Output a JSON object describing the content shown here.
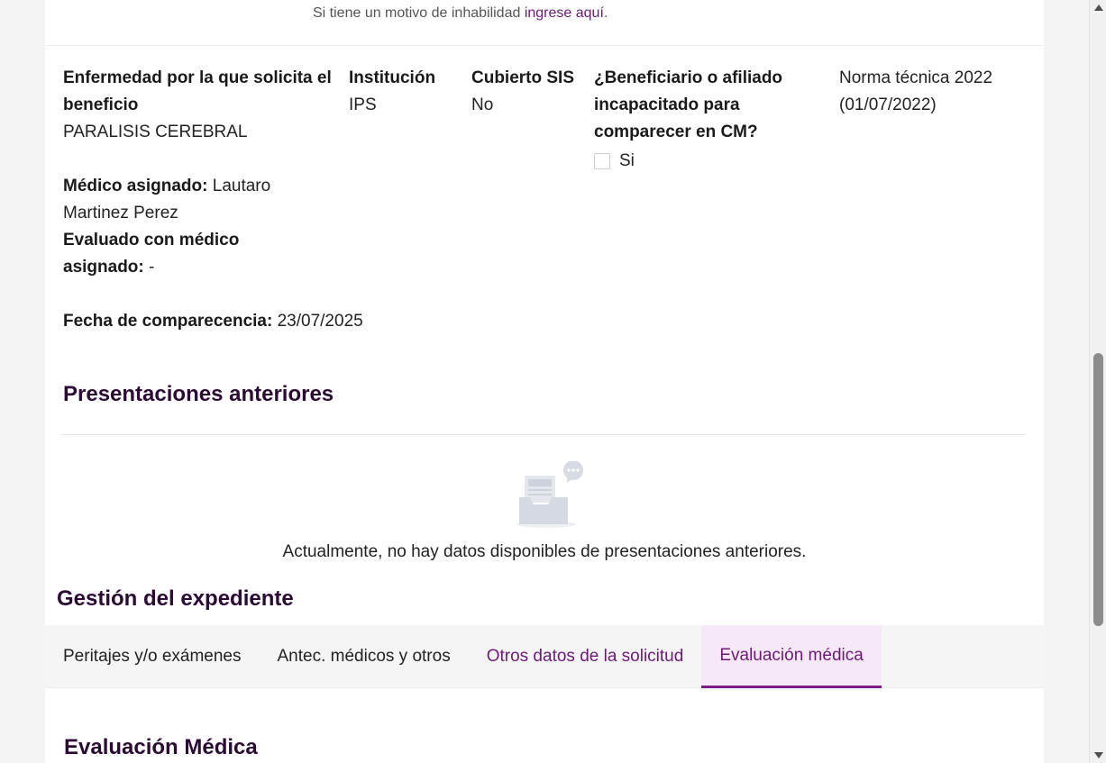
{
  "top_note": {
    "text": "Si tiene un motivo de inhabilidad ",
    "link": "ingrese aquí",
    "suffix": "."
  },
  "fields": {
    "enfermedad_label": "Enfermedad por la que solicita el beneficio",
    "enfermedad_value": "PARALISIS CEREBRAL",
    "institucion_label": "Institución",
    "institucion_value": "IPS",
    "sis_label": "Cubierto SIS",
    "sis_value": "No",
    "beneficiario_label": "¿Beneficiario o afiliado incapacitado para comparecer en CM?",
    "beneficiario_check": "Si",
    "norma": "Norma técnica 2022 (01/07/2022)",
    "medico_label": "Médico asignado:",
    "medico_value": "Lautaro Martinez Perez",
    "evaluado_label": "Evaluado con médico asignado:",
    "evaluado_value": "-",
    "fecha_label": "Fecha de comparecencia:",
    "fecha_value": "23/07/2025"
  },
  "presentaciones": {
    "title": "Presentaciones anteriores",
    "empty_text": "Actualmente, no hay datos disponibles de presentaciones anteriores."
  },
  "gestion": {
    "title": "Gestión del expediente",
    "tabs": [
      {
        "label": "Peritajes y/o exámenes"
      },
      {
        "label": "Antec. médicos y otros"
      },
      {
        "label": "Otros datos de la solicitud"
      },
      {
        "label": "Evaluación médica"
      }
    ]
  },
  "evaluacion": {
    "title": "Evaluación Médica"
  },
  "colors": {
    "accent": "#6d1a77",
    "title": "#2b0a33",
    "active_tab_bg": "#f6e8f6"
  },
  "icons": {
    "empty_state": "inbox-chat-icon",
    "scroll_up": "arrow-up-icon",
    "scroll_down": "arrow-down-icon"
  }
}
